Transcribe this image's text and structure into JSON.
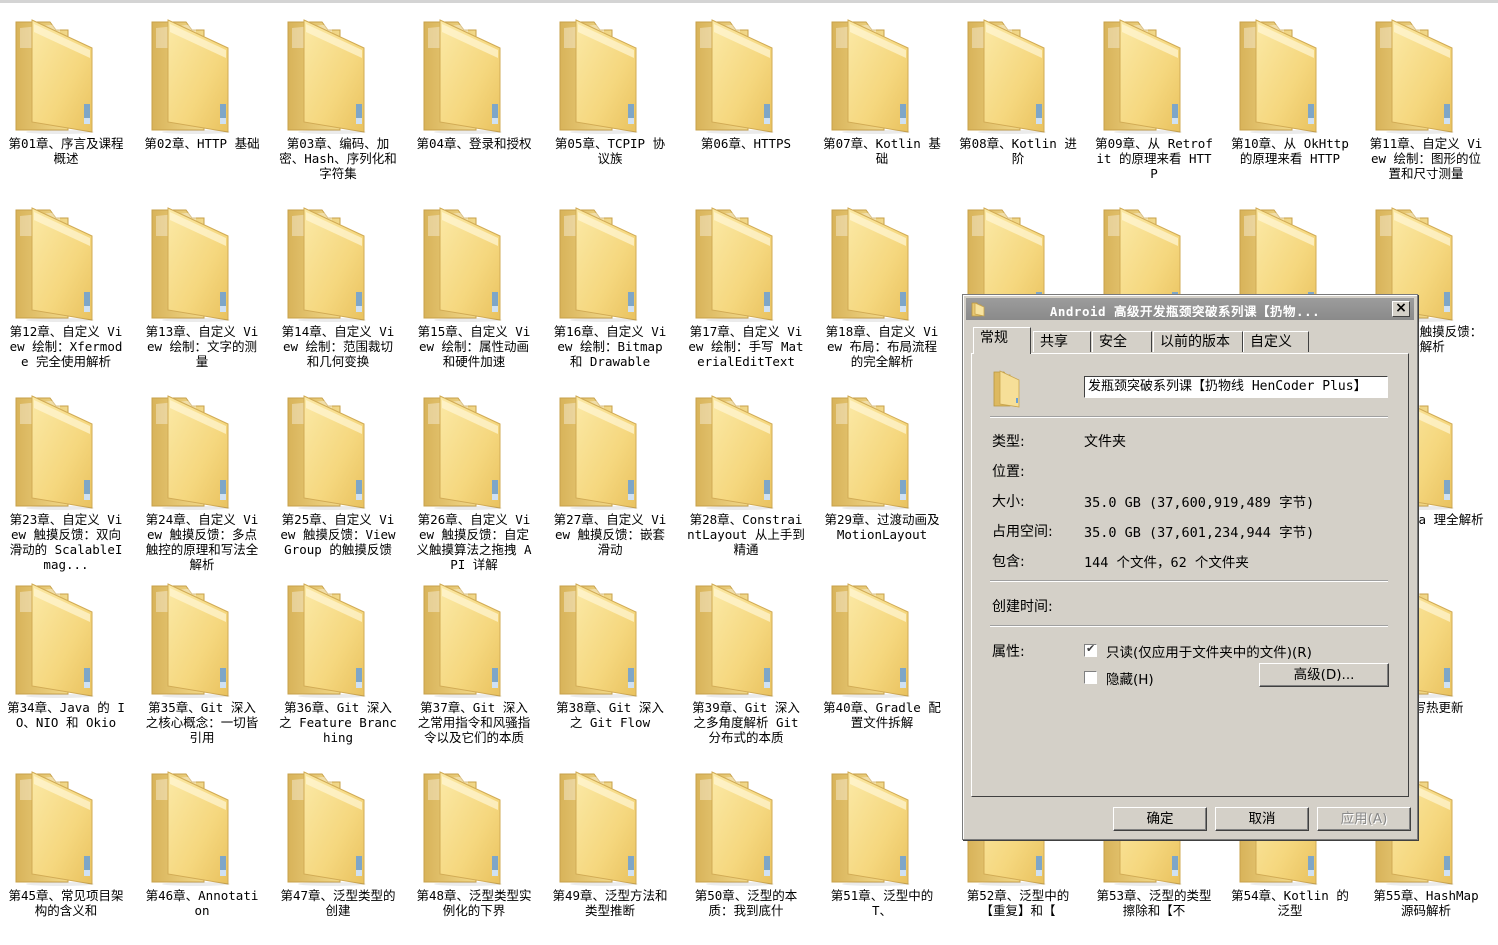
{
  "folders": [
    "第01章、序言及课程概述",
    "第02章、HTTP 基础",
    "第03章、编码、加密、Hash、序列化和字符集",
    "第04章、登录和授权",
    "第05章、TCPIP 协议族",
    "第06章、HTTPS",
    "第07章、Kotlin 基础",
    "第08章、Kotlin 进阶",
    "第09章、从 Retrofit 的原理来看 HTTP",
    "第10章、从 OkHttp 的原理来看 HTTP",
    "第11章、自定义 View 绘制：图形的位置和尺寸测量",
    "第12章、自定义 View 绘制：Xfermode 完全使用解析",
    "第13章、自定义 View 绘制：文字的测量",
    "第14章、自定义 View 绘制：范围裁切和几何变换",
    "第15章、自定义 View 绘制：属性动画和硬件加速",
    "第16章、自定义 View 绘制：Bitmap 和 Drawable",
    "第17章、自定义 View 绘制：手写 MaterialEditText",
    "第18章、自定义 View 布局：布局流程的完全解析",
    "",
    "",
    "",
    "、自定义触摸反馈：全解析",
    "第23章、自定义 View 触摸反馈：双向滑动的 ScalableImag...",
    "第24章、自定义 View 触摸反馈：多点触控的原理和写法全解析",
    "第25章、自定义 View 触摸反馈：ViewGroup 的触摸反馈",
    "第26章、自定义 View 触摸反馈：自定义触摸算法之拖拽 API 详解",
    "第27章、自定义 View 触摸反馈：嵌套滑动",
    "第28章、ConstraintLayout 从上手到精通",
    "第29章、过渡动画及 MotionLayout",
    "",
    "",
    "",
    "、RxJava 理全解析",
    "第34章、Java 的 IO、NIO 和 Okio",
    "第35章、Git 深入之核心概念：一切皆引用",
    "第36章、Git 深入之 Feature Branching",
    "第37章、Git 深入之常用指令和风骚指令以及它们的本质",
    "第38章、Git 深入之 Git Flow",
    "第39章、Git 深入之多角度解析 Git 分布式的本质",
    "第40章、Gradle 配置文件拆解",
    "",
    "",
    "",
    "、手写热更新",
    "第45章、常见项目架构的含义和",
    "第46章、Annotation",
    "第47章、泛型类型的创建",
    "第48章、泛型类型实例化的下界",
    "第49章、泛型方法和类型推断",
    "第50章、泛型的本质：我到底什",
    "第51章、泛型中的 T、",
    "第52章、泛型中的【重复】和【",
    "第53章、泛型的类型擦除和【不",
    "第54章、Kotlin 的泛型",
    "第55章、HashMap 源码解析"
  ],
  "dialog": {
    "title": "Android 高级开发瓶颈突破系列课【扔物...",
    "close_glyph": "×",
    "tabs": [
      "常规",
      "共享",
      "安全",
      "以前的版本",
      "自定义"
    ],
    "name_value": "发瓶颈突破系列课【扔物线 HenCoder Plus】",
    "props": {
      "type_label": "类型:",
      "type_value": "文件夹",
      "location_label": "位置:",
      "location_value": "",
      "size_label": "大小:",
      "size_value": "35.0 GB (37,600,919,489 字节)",
      "disk_label": "占用空间:",
      "disk_value": "35.0 GB (37,601,234,944 字节)",
      "contains_label": "包含:",
      "contains_value": "144 个文件，62 个文件夹",
      "created_label": "创建时间:",
      "created_value": "",
      "attrs_label": "属性:"
    },
    "readonly_label": "只读(仅应用于文件夹中的文件)(R)",
    "readonly_checked": true,
    "hidden_label": "隐藏(H)",
    "hidden_checked": false,
    "advanced_button": "高级(D)...",
    "ok_button": "确定",
    "cancel_button": "取消",
    "apply_button": "应用(A)"
  }
}
